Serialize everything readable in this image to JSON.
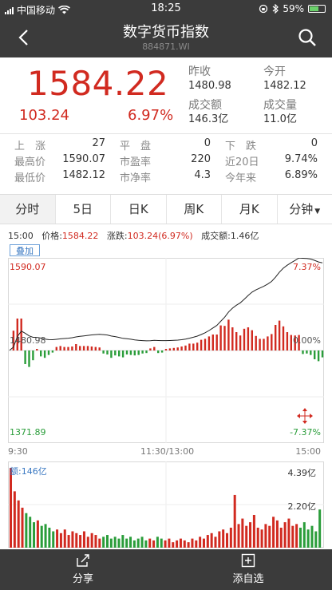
{
  "status_bar": {
    "carrier": "中国移动",
    "time": "18:25",
    "battery": "59%",
    "battery_level": 0.59
  },
  "nav": {
    "title": "数字货币指数",
    "code": "884871.WI"
  },
  "quote": {
    "price": "1584.22",
    "change": "103.24",
    "change_pct": "6.97%",
    "prev_close_label": "昨收",
    "prev_close": "1480.98",
    "open_label": "今开",
    "open": "1482.12",
    "turnover_label": "成交额",
    "turnover": "146.3亿",
    "volume_label": "成交量",
    "volume": "11.0亿"
  },
  "stats": {
    "rows": [
      [
        {
          "label": "上　涨",
          "value": "27"
        },
        {
          "label": "平　盘",
          "value": "0"
        },
        {
          "label": "下　跌",
          "value": "0"
        }
      ],
      [
        {
          "label": "最高价",
          "value": "1590.07"
        },
        {
          "label": "市盈率",
          "value": "220"
        },
        {
          "label": "近20日",
          "value": "9.74%"
        }
      ],
      [
        {
          "label": "最低价",
          "value": "1482.12"
        },
        {
          "label": "市净率",
          "value": "4.3"
        },
        {
          "label": "今年来",
          "value": "6.89%"
        }
      ]
    ]
  },
  "tabs": [
    "分时",
    "5日",
    "日K",
    "周K",
    "月K",
    "分钟"
  ],
  "info_bar": {
    "time": "15:00",
    "price_label": "价格:",
    "price": "1584.22",
    "change_label": "涨跌:",
    "change": "103.24(6.97%)",
    "turnover_label": "成交额:",
    "turnover": "1.46亿"
  },
  "overlay_button": "叠加",
  "chart_labels": {
    "top_price": "1590.07",
    "top_pct": "7.37%",
    "mid_price": "1480.98",
    "mid_pct": "0.00%",
    "bottom_price": "1371.89",
    "bottom_pct": "-7.37%"
  },
  "time_axis": [
    "9:30",
    "11:30/13:00",
    "15:00"
  ],
  "volume_labels": {
    "left": "额:146亿",
    "top": "4.39亿",
    "mid": "2.20亿"
  },
  "bottom_actions": {
    "share": "分享",
    "watchlist": "添自选"
  },
  "colors": {
    "up": "#d12a20",
    "down": "#2a9d3a",
    "bar": "#3b3b3b",
    "line": "#222222"
  },
  "chart_data": {
    "type": "line",
    "title": "",
    "x_ticks": [
      "9:30",
      "11:30/13:00",
      "15:00"
    ],
    "ylim": [
      1371.89,
      1590.07
    ],
    "ylabel_right_pct": [
      "7.37%",
      "0.00%",
      "-7.37%"
    ],
    "series": [
      {
        "values": [
          1481.2,
          1485.0,
          1497.3,
          1503.8,
          1501.3,
          1498.2,
          1496.5,
          1496.5,
          1495.6,
          1494.4,
          1493.8,
          1493.7,
          1494.1,
          1494.7,
          1495.1,
          1495.5,
          1496.0,
          1497.0,
          1497.6,
          1498.2,
          1498.8,
          1499.3,
          1499.7,
          1500.0,
          1499.7,
          1499.2,
          1498.0,
          1497.3,
          1496.4,
          1495.3,
          1494.8,
          1494.2,
          1493.5,
          1492.9,
          1492.6,
          1492.4,
          1492.5,
          1492.9,
          1492.7,
          1492.6,
          1492.6,
          1492.7,
          1492.9,
          1493.2,
          1493.7,
          1494.4,
          1495.5,
          1496.6,
          1497.9,
          1499.8,
          1501.9,
          1504.5,
          1507.5,
          1510.5,
          1515.4,
          1520.2,
          1526.3,
          1530.8,
          1534.3,
          1537.1,
          1541.3,
          1545.8,
          1549.7,
          1552.4,
          1554.5,
          1556.6,
          1559.2,
          1562.3,
          1567.3,
          1573.2,
          1577.9,
          1581.4,
          1584.3,
          1587.1,
          1590.0,
          1589.6,
          1589.3,
          1588.7,
          1587.2,
          1585.3,
          1584.2
        ]
      }
    ],
    "volume": [
      4.39,
      3.1,
      2.6,
      2.2,
      1.9,
      1.7,
      1.4,
      1.5,
      1.2,
      1.3,
      1.1,
      0.9,
      1.0,
      0.8,
      1.0,
      0.7,
      0.9,
      0.8,
      0.7,
      0.9,
      0.6,
      0.8,
      0.7,
      0.5,
      0.6,
      0.7,
      0.5,
      0.6,
      0.5,
      0.7,
      0.5,
      0.6,
      0.4,
      0.5,
      0.6,
      0.4,
      0.5,
      0.4,
      0.6,
      0.5,
      0.4,
      0.5,
      0.3,
      0.4,
      0.5,
      0.4,
      0.3,
      0.5,
      0.4,
      0.6,
      0.5,
      0.7,
      0.8,
      0.6,
      0.9,
      1.0,
      0.8,
      1.1,
      2.9,
      1.3,
      1.6,
      1.2,
      1.4,
      1.8,
      1.1,
      1.0,
      1.3,
      1.2,
      1.7,
      1.5,
      1.1,
      1.4,
      1.6,
      1.2,
      1.3,
      1.1,
      1.4,
      1.0,
      1.2,
      0.9,
      2.1
    ]
  }
}
